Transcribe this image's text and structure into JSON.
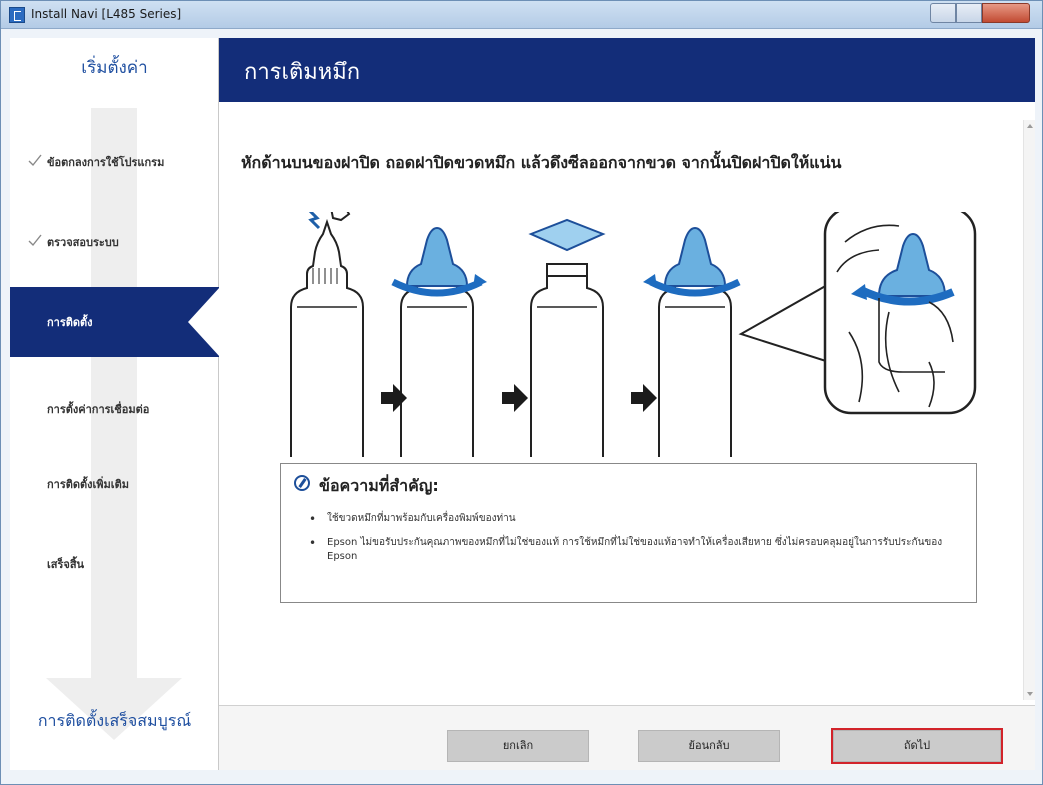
{
  "window": {
    "title": "Install Navi [L485 Series]",
    "tabs": [
      "",
      ""
    ]
  },
  "sidebar": {
    "header": "เริ่มตั้งค่า",
    "steps": [
      {
        "label": "ข้อตกลงการใช้โปรแกรม",
        "done": true
      },
      {
        "label": "ตรวจสอบระบบ",
        "done": true
      },
      {
        "label": "การติดตั้ง",
        "active": true
      },
      {
        "label": "การตั้งค่าการเชื่อมต่อ"
      },
      {
        "label": "การติดตั้งเพิ่มเติม"
      },
      {
        "label": "เสร็จสิ้น"
      }
    ],
    "footer": "การติดตั้งเสร็จสมบูรณ์"
  },
  "main": {
    "title": "การเติมหมึก",
    "instruction": "หักด้านบนของฝาปิด ถอดฝาปิดขวดหมึก แล้วดึงซีลออกจากขวด จากนั้นปิดฝาปิดให้แน่น",
    "notice": {
      "title": "ข้อความที่สำคัญ:",
      "items": [
        "ใช้ขวดหมึกที่มาพร้อมกับเครื่องพิมพ์ของท่าน",
        "Epson ไม่ขอรับประกันคุณภาพของหมึกที่ไม่ใช่ของแท้  การใช้หมึกที่ไม่ใช่ของแท้อาจทำให้เครื่องเสียหาย  ซึ่งไม่ครอบคลุมอยู่ในการรับประกันของ  Epson"
      ]
    }
  },
  "footer": {
    "cancel": "ยกเลิก",
    "back": "ย้อนกลับ",
    "next": "ถัดไป"
  },
  "colors": {
    "header_bg": "#132d79",
    "accent_blue": "#6ab0e0",
    "highlight_red": "#d2232a"
  }
}
